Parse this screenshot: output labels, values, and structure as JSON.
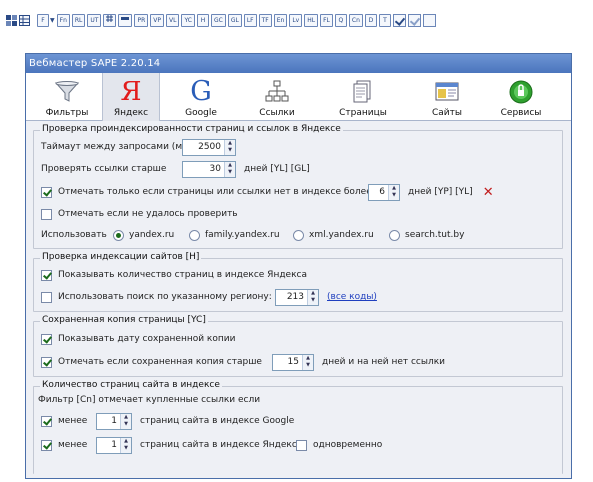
{
  "toolbar": {
    "buttons": [
      "F",
      "Fn",
      "RL",
      "UT",
      "",
      "",
      "PR",
      "VP",
      "VL",
      "YC",
      "H",
      "GC",
      "GL",
      "LF",
      "TF",
      "En",
      "Lv",
      "HL",
      "FL",
      "Q",
      "Cn",
      "D",
      "T"
    ]
  },
  "window": {
    "title": "Вебмастер SAPE 2.20.14",
    "tabs": [
      {
        "label": "Фильтры",
        "icon": "funnel-icon"
      },
      {
        "label": "Яндекс",
        "icon": "yandex-icon"
      },
      {
        "label": "Google",
        "icon": "google-icon"
      },
      {
        "label": "Ссылки",
        "icon": "links-tree-icon"
      },
      {
        "label": "Страницы",
        "icon": "pages-icon"
      },
      {
        "label": "Сайты",
        "icon": "sites-icon"
      },
      {
        "label": "Сервисы",
        "icon": "services-icon"
      }
    ],
    "active_tab": "Яндекс",
    "accent": "#4b75bd"
  },
  "index_check": {
    "title": "Проверка проиндексированности страниц и ссылок в Яндексе",
    "timeout_label": "Таймаут между запросами (мс):",
    "timeout_value": "2500",
    "check_older_label": "Проверять ссылки старше",
    "check_older_value": "30",
    "check_older_suffix": "дней [YL] [GL]",
    "mark_only_label": "Отмечать только если страницы или ссылки нет в индексе более",
    "mark_only_value": "6",
    "mark_only_suffix": "дней [YP] [YL]",
    "mark_failed_label": "Отмечать если не удалось проверить",
    "use_label": "Использовать",
    "engines": [
      "yandex.ru",
      "family.yandex.ru",
      "xml.yandex.ru",
      "search.tut.by"
    ],
    "selected_engine": "yandex.ru"
  },
  "site_index": {
    "title": "Проверка индексации сайтов [H]",
    "show_count_label": "Показывать количество страниц в индексе Яндекса",
    "region_label": "Использовать поиск по указанному региону:",
    "region_value": "213",
    "all_codes_link": "(все коды)"
  },
  "cache": {
    "title": "Сохраненная копия страницы [YC]",
    "show_date_label": "Показывать дату сохраненной копии",
    "mark_older_label": "Отмечать если сохраненная копия старше",
    "mark_older_value": "15",
    "mark_older_suffix": "дней и на ней нет ссылки"
  },
  "page_count": {
    "title": "Количество страниц сайта в индексе",
    "filter_note": "Фильтр [Cn] отмечает купленные ссылки если",
    "less_label": "менее",
    "google_value": "1",
    "google_suffix": "страниц сайта в индексе Google",
    "yandex_value": "1",
    "yandex_suffix": "страниц сайта в индексе Яндекс",
    "simultaneous_label": "одновременно"
  }
}
